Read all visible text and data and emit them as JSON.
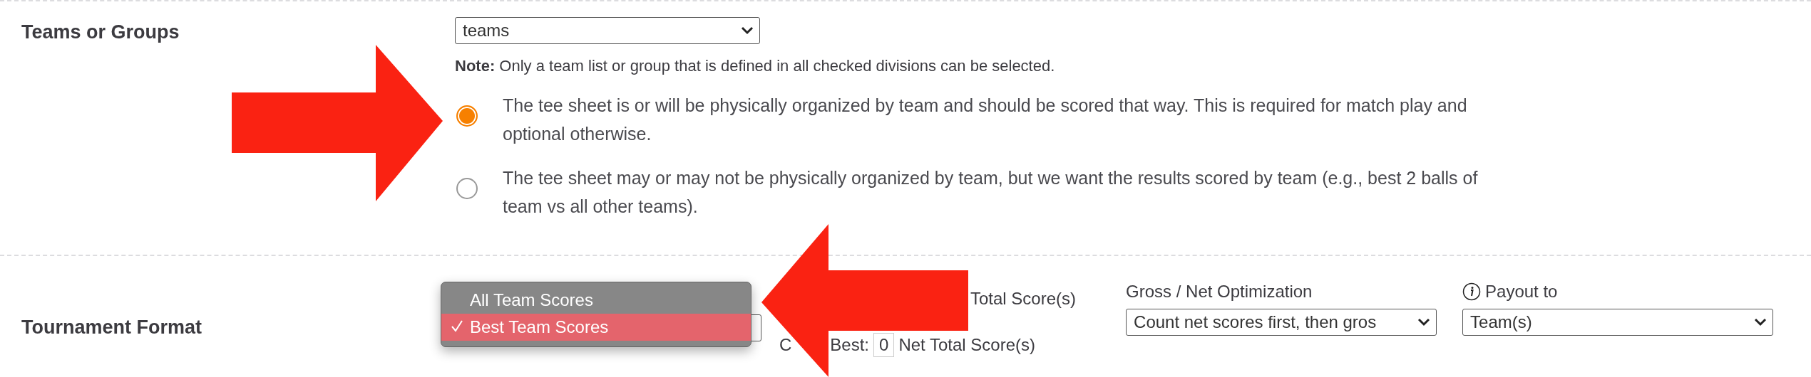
{
  "teams_section": {
    "title": "Teams or Groups",
    "select": {
      "value": "teams"
    },
    "note": "**Note:** Only a team list or group that is defined in all checked divisions can be selected.",
    "options": [
      {
        "text": "The tee sheet is or will be physically organized by team and should be scored that way. This is required for match play and optional otherwise.",
        "selected": true
      },
      {
        "text": "The tee sheet may or may not be physically organized by team, but we want the results scored by team (e.g., best 2 balls of team vs all other teams).",
        "selected": false
      }
    ]
  },
  "format_section": {
    "title": "Tournament Format",
    "format_dropdown": [
      {
        "label": "All Team Scores",
        "selected": false
      },
      {
        "label": "Best Team Scores",
        "selected": true
      }
    ],
    "count": {
      "line_1": "Total Score(s)",
      "prefix": "C",
      "best_label": "Best:",
      "value": "0",
      "suffix": "Net Total Score(s)"
    },
    "optimization": {
      "label": "Gross / Net Optimization",
      "value": "Count net scores first, then gros"
    },
    "payout": {
      "label": "Payout to",
      "value": "Team(s)"
    }
  },
  "annotations": [
    {
      "kind": "arrow-right"
    },
    {
      "kind": "arrow-left"
    }
  ]
}
